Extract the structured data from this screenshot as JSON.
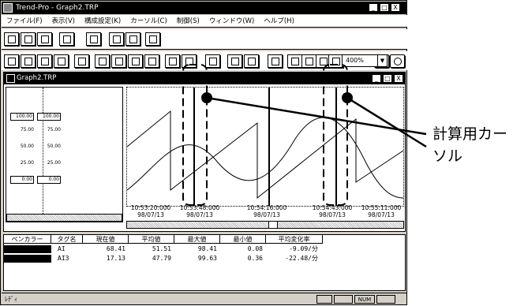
{
  "app": {
    "title": "Trend-Pro - Graph2.TRP",
    "window_buttons": [
      "_",
      "□",
      "X"
    ]
  },
  "menu": [
    "ファイル(F)",
    "表示(V)",
    "構成設定(K)",
    "カーソル(C)",
    "制御(S)",
    "ウィンドウ(W)",
    "ヘルプ(H)"
  ],
  "toolbar": {
    "row1_icons": [
      "new-icon",
      "open-icon",
      "save-icon",
      "print-setup-icon",
      "calculator-icon",
      "print-icon",
      "print-preview-icon",
      "export-icon"
    ],
    "row2_icons": [
      "trend-icon",
      "graph-edit-icon",
      "pen-icon",
      "graph-icon",
      "table-icon",
      "split-icon",
      "split2-icon",
      "split3-icon",
      "split4-icon",
      "scroll-left-icon",
      "scroll-right-icon",
      "capture-icon",
      "anchor-icon",
      "report-icon",
      "grid-icon",
      "window1-icon",
      "window2-icon",
      "window3-icon",
      "window4-icon"
    ],
    "zoom_value": "400%",
    "zoom_in_icon": "zoom-in-icon",
    "zoom_out_icon": "zoom-out-icon"
  },
  "child": {
    "title": "Graph2.TRP",
    "scale_left": [
      "100.00",
      "75.00",
      "50.00",
      "25.00",
      "0.00"
    ],
    "scale_right": [
      "100.00",
      "75.00",
      "50.00",
      "25.00",
      "0.00"
    ],
    "time_labels": [
      {
        "time": "10:53:20:000",
        "date": "98/07/13"
      },
      {
        "time": "10:53:48:000",
        "date": "98/07/13"
      },
      {
        "time": "10:54:16:000",
        "date": "98/07/13"
      },
      {
        "time": "10:54:43:000",
        "date": "98/07/13"
      },
      {
        "time": "10:55:11:000",
        "date": "98/07/13"
      }
    ]
  },
  "table": {
    "headers": [
      "ペンカラー",
      "タグ名",
      "現在値",
      "平均値",
      "最大値",
      "最小値",
      "平均変化率"
    ],
    "rows": [
      {
        "tag": "AI",
        "current": "68.41",
        "avg": "51.51",
        "max": "98.41",
        "min": "0.08",
        "rate": "-9.09/分"
      },
      {
        "tag": "AI3",
        "current": "17.13",
        "avg": "47.79",
        "max": "99.63",
        "min": "0.36",
        "rate": "-22.48/分"
      }
    ]
  },
  "status": {
    "left": "ﾚﾃﾞｨ",
    "num": "NUM"
  },
  "annotation": {
    "line1": "計算用カー",
    "line2": "ソル"
  },
  "colors": {
    "pen1": "#000000",
    "pen2": "#000000"
  }
}
